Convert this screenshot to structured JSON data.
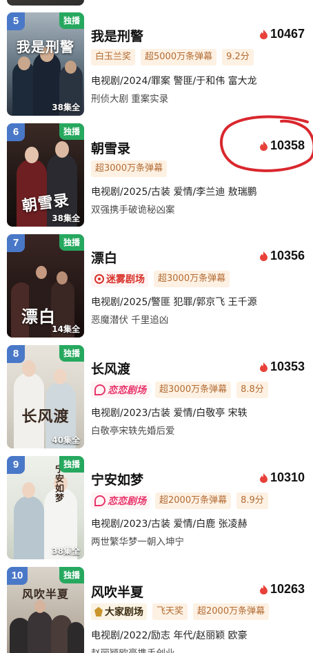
{
  "items": [
    {
      "rank": "5",
      "exclusive": "独播",
      "episodes": "38集全",
      "poster_title": "我是刑警",
      "title": "我是刑警",
      "heat": "10467",
      "tags": [
        "白玉兰奖",
        "超5000万条弹幕",
        "9.2分"
      ],
      "meta": "电视剧/2024/罪案 警匪/于和伟 富大龙",
      "desc": "刑侦大剧 重案实录"
    },
    {
      "rank": "6",
      "exclusive": "独播",
      "episodes": "38集全",
      "poster_title": "朝雪录",
      "title": "朝雪录",
      "heat": "10358",
      "tags": [
        "超3000万条弹幕"
      ],
      "meta": "电视剧/2025/古装 爱情/李兰迪 敖瑞鹏",
      "desc": "双强携手破诡秘凶案"
    },
    {
      "rank": "7",
      "exclusive": "独播",
      "episodes": "14集全",
      "poster_title": "漂白",
      "title": "漂白",
      "heat": "10356",
      "brand": "迷雾剧场",
      "tags": [
        "超3000万条弹幕"
      ],
      "meta": "电视剧/2025/警匪 犯罪/郭京飞 王千源",
      "desc": "恶魔潜伏 千里追凶"
    },
    {
      "rank": "8",
      "exclusive": "独播",
      "episodes": "40集全",
      "poster_title": "长风渡",
      "title": "长风渡",
      "heat": "10353",
      "brand": "恋恋剧场",
      "tags": [
        "超3000万条弹幕",
        "8.8分"
      ],
      "meta": "电视剧/2023/古装 爱情/白敬亭 宋轶",
      "desc": "白敬亭宋轶先婚后爱"
    },
    {
      "rank": "9",
      "exclusive": "独播",
      "episodes": "38集全",
      "poster_title": "宁安如梦",
      "title": "宁安如梦",
      "heat": "10310",
      "brand": "恋恋剧场",
      "tags": [
        "超2000万条弹幕",
        "8.9分"
      ],
      "meta": "电视剧/2023/古装 爱情/白鹿 张凌赫",
      "desc": "两世繁华梦一朝入坤宁"
    },
    {
      "rank": "10",
      "exclusive": "独播",
      "episodes": "",
      "poster_title": "风吹半夏",
      "title": "风吹半夏",
      "heat": "10263",
      "brand": "大家剧场",
      "tags": [
        "飞天奖",
        "超2000万条弹幕"
      ],
      "meta": "电视剧/2022/励志 年代/赵丽颖 欧豪",
      "desc": "赵丽颖欧豪携手创业"
    }
  ],
  "colors": {
    "rank_bg": "#4a78c8",
    "exclusive_bg": "#26a85f",
    "tag_text": "#b26b33",
    "tag_bg": "#fdf1e3",
    "flame": "#e8413a",
    "annotation_circle": "#d9272e"
  },
  "icons": {
    "heat": "flame-icon"
  }
}
